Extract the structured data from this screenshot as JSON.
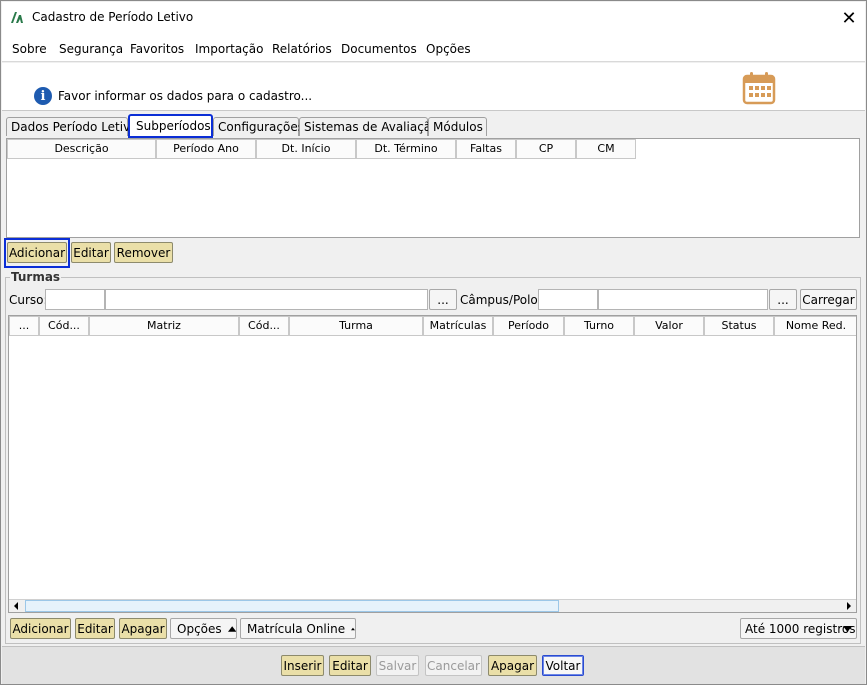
{
  "window": {
    "title": "Cadastro de Período Letivo",
    "close_symbol": "✕"
  },
  "menu": [
    "Sobre",
    "Segurança",
    "Favoritos",
    "Importação",
    "Relatórios",
    "Documentos",
    "Opções"
  ],
  "info": {
    "text": "Favor informar os dados para o cadastro...",
    "info_symbol": "i"
  },
  "tabs": [
    "Dados Período Letivo",
    "Subperíodos",
    "Configurações",
    "Sistemas de Avaliação",
    "Módulos"
  ],
  "subperiodos": {
    "columns": [
      "Descrição",
      "Período Ano",
      "Dt. Início",
      "Dt. Término",
      "Faltas",
      "CP",
      "CM"
    ],
    "buttons": {
      "add": "Adicionar",
      "edit": "Editar",
      "remove": "Remover"
    }
  },
  "turmas": {
    "legend": "Turmas",
    "curso_label": "Curso:",
    "campus_label": "Câmpus/Polo:",
    "browse_symbol": "...",
    "carregar": "Carregar",
    "columns": [
      "...",
      "Cód...",
      "Matriz",
      "Cód...",
      "Turma",
      "Matrículas",
      "Período",
      "Turno",
      "Valor",
      "Status",
      "Nome Red."
    ],
    "buttons": {
      "add": "Adicionar",
      "edit": "Editar",
      "delete": "Apagar",
      "options": "Opções",
      "online": "Matrícula Online"
    },
    "records_select": "Até 1000 registros"
  },
  "footer": {
    "inserir": "Inserir",
    "editar": "Editar",
    "salvar": "Salvar",
    "cancelar": "Cancelar",
    "apagar": "Apagar",
    "voltar": "Voltar"
  },
  "colors": {
    "button": "#eadfa8",
    "highlight": "#0b2ed6",
    "info_blue": "#1e5bb0",
    "calendar": "#d79b57"
  }
}
